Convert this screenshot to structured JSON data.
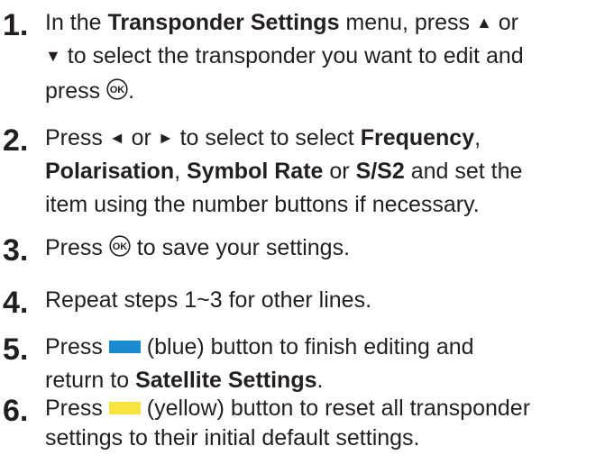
{
  "colors": {
    "blue_button": "#1a8ad1",
    "yellow_button": "#f7e43e",
    "text": "#231f20"
  },
  "icons": {
    "ok_button": "ok-button-icon",
    "up": "up-arrow-icon",
    "down": "down-arrow-icon",
    "left": "left-arrow-icon",
    "right": "right-arrow-icon"
  },
  "ok_label": "OK",
  "symbols": {
    "up": "▲",
    "down": "▼",
    "left": "◄",
    "right": "►"
  },
  "steps": [
    {
      "number": "1.",
      "t1": "In the ",
      "t2": "Transponder Settings",
      "t3": " menu, press ",
      "t4": " or",
      "t5": " to select the transponder you want to edit and",
      "t6": "press ",
      "t7": "."
    },
    {
      "number": "2.",
      "t1": "Press ",
      "t2": " or ",
      "t3": " to select to select ",
      "t4": "Frequency",
      "t5": ",",
      "t6": "Polarisation",
      "t7": ", ",
      "t8": "Symbol Rate",
      "t9": " or ",
      "t10": "S/S2",
      "t11": " and set the",
      "t12": "item using the number buttons if necessary."
    },
    {
      "number": "3.",
      "t1": "Press ",
      "t2": " to save your settings."
    },
    {
      "number": "4.",
      "t1": "Repeat steps 1~3 for other lines."
    },
    {
      "number": "5.",
      "t1": "Press ",
      "t2": " (blue) button to finish editing and",
      "t3": "return to ",
      "t4": "Satellite Settings",
      "t5": "."
    },
    {
      "number": "6.",
      "t1": "Press ",
      "t2": " (yellow) button to reset all transponder",
      "t3": "settings to their initial default settings."
    }
  ]
}
